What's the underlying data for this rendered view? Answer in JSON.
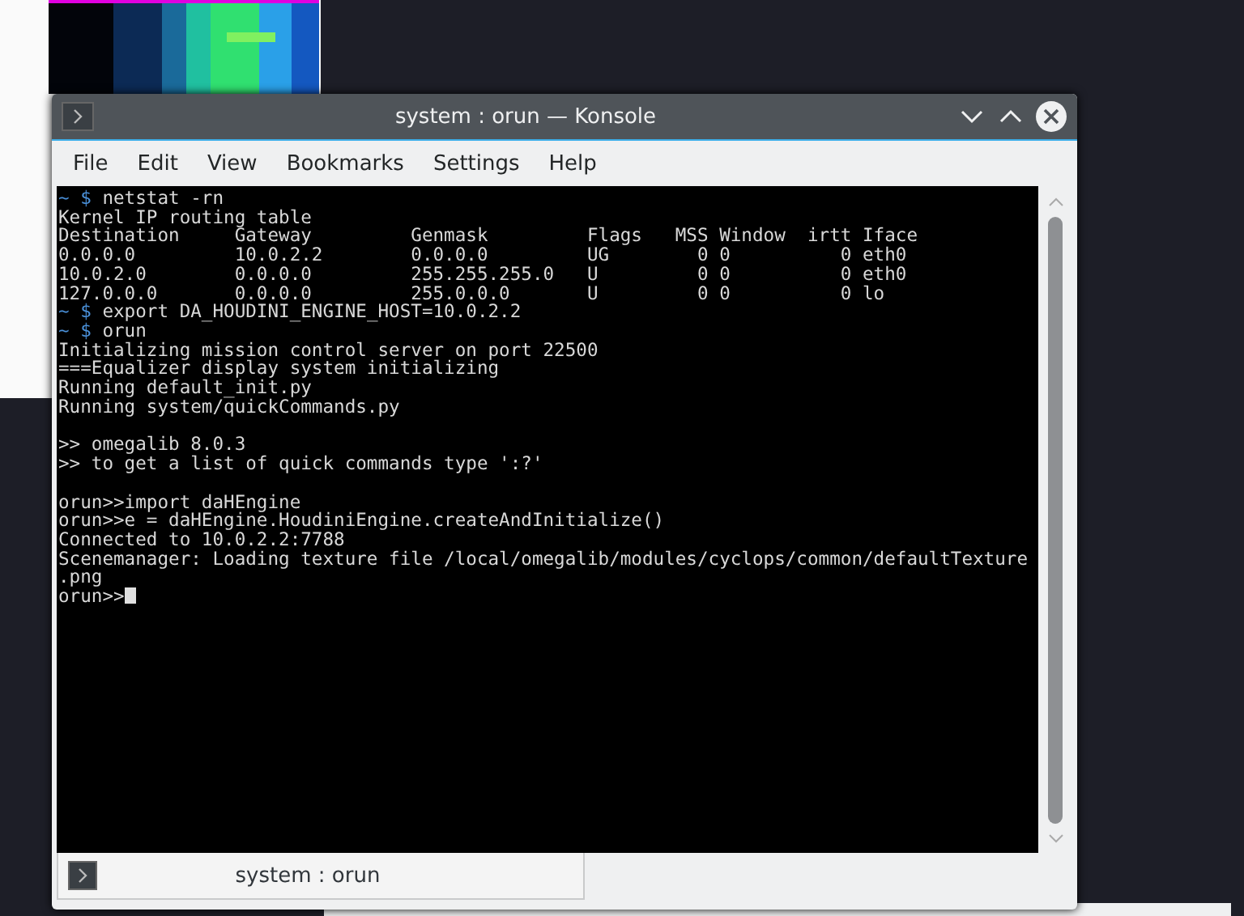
{
  "window": {
    "title": "system : orun — Konsole"
  },
  "menu": [
    "File",
    "Edit",
    "View",
    "Bookmarks",
    "Settings",
    "Help"
  ],
  "terminal": {
    "lines": [
      {
        "kind": "prompt",
        "prompt": "~ $",
        "text": "netstat -rn"
      },
      {
        "kind": "output",
        "text": "Kernel IP routing table"
      },
      {
        "kind": "output",
        "text": "Destination     Gateway         Genmask         Flags   MSS Window  irtt Iface"
      },
      {
        "kind": "output",
        "text": "0.0.0.0         10.0.2.2        0.0.0.0         UG        0 0          0 eth0"
      },
      {
        "kind": "output",
        "text": "10.0.2.0        0.0.0.0         255.255.255.0   U         0 0          0 eth0"
      },
      {
        "kind": "output",
        "text": "127.0.0.0       0.0.0.0         255.0.0.0       U         0 0          0 lo"
      },
      {
        "kind": "prompt",
        "prompt": "~ $",
        "text": "export DA_HOUDINI_ENGINE_HOST=10.0.2.2"
      },
      {
        "kind": "prompt",
        "prompt": "~ $",
        "text": "orun"
      },
      {
        "kind": "output",
        "text": "Initializing mission control server on port 22500"
      },
      {
        "kind": "output",
        "text": "===Equalizer display system initializing"
      },
      {
        "kind": "output",
        "text": "Running default_init.py"
      },
      {
        "kind": "output",
        "text": "Running system/quickCommands.py"
      },
      {
        "kind": "blank"
      },
      {
        "kind": "output",
        "text": ">> omegalib 8.0.3"
      },
      {
        "kind": "output",
        "text": ">> to get a list of quick commands type ':?'"
      },
      {
        "kind": "blank"
      },
      {
        "kind": "output",
        "text": "orun>>import daHEngine"
      },
      {
        "kind": "output",
        "text": "orun>>e = daHEngine.HoudiniEngine.createAndInitialize()"
      },
      {
        "kind": "output",
        "text": "Connected to 10.0.2.2:7788"
      },
      {
        "kind": "output",
        "text": "Scenemanager: Loading texture file /local/omegalib/modules/cyclops/common/defaultTexture"
      },
      {
        "kind": "output",
        "text": ".png"
      },
      {
        "kind": "cursor",
        "text": "orun>>"
      }
    ]
  },
  "tabs": [
    {
      "label": "system : orun",
      "selected": true
    }
  ]
}
